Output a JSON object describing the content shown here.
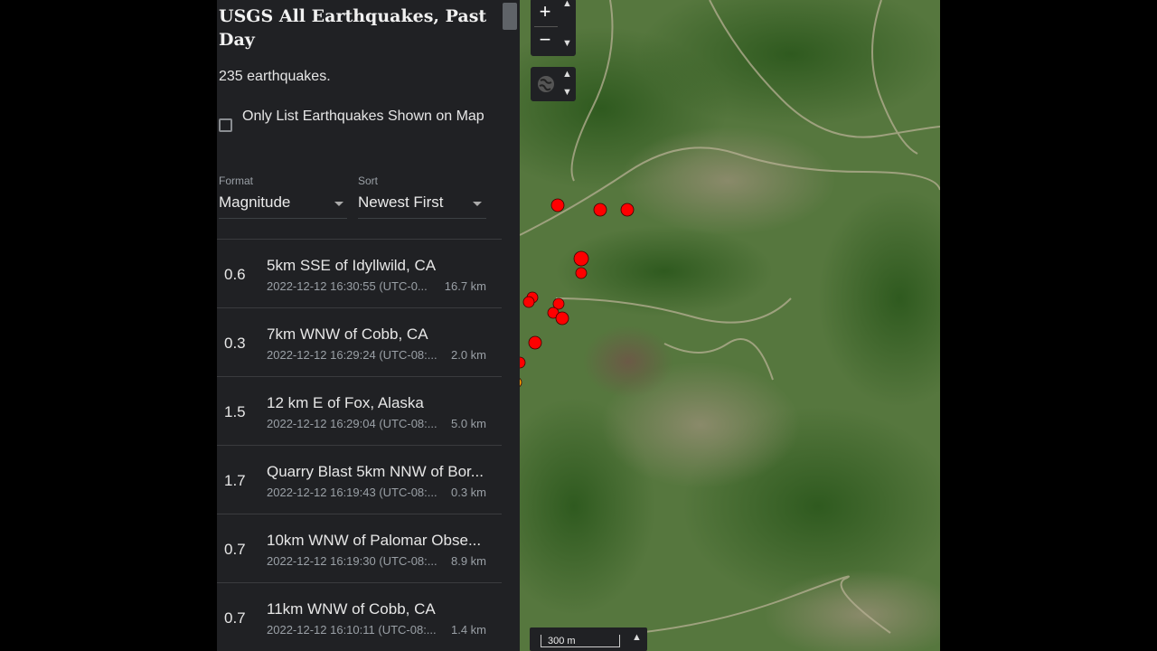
{
  "sidebar": {
    "title": "USGS All Earthquakes, Past Day",
    "count_text": "235 earthquakes.",
    "only_list_label": "Only List Earthquakes Shown on Map",
    "format": {
      "caption": "Format",
      "value": "Magnitude"
    },
    "sort": {
      "caption": "Sort",
      "value": "Newest First"
    },
    "events": [
      {
        "mag": "0.6",
        "place": "5km SSE of Idyllwild, CA",
        "time": "2022-12-12 16:30:55 (UTC-0...",
        "depth": "16.7 km"
      },
      {
        "mag": "0.3",
        "place": "7km WNW of Cobb, CA",
        "time": "2022-12-12 16:29:24 (UTC-08:...",
        "depth": "2.0 km"
      },
      {
        "mag": "1.5",
        "place": "12 km E of Fox, Alaska",
        "time": "2022-12-12 16:29:04 (UTC-08:...",
        "depth": "5.0 km"
      },
      {
        "mag": "1.7",
        "place": "Quarry Blast 5km NNW of Bor...",
        "time": "2022-12-12 16:19:43 (UTC-08:...",
        "depth": "0.3 km"
      },
      {
        "mag": "0.7",
        "place": "10km WNW of Palomar Obse...",
        "time": "2022-12-12 16:19:30 (UTC-08:...",
        "depth": "8.9 km"
      },
      {
        "mag": "0.7",
        "place": "11km WNW of Cobb, CA",
        "time": "2022-12-12 16:10:11 (UTC-08:...",
        "depth": "1.4 km"
      }
    ]
  },
  "map": {
    "zoom_in": "+",
    "zoom_out": "−",
    "scale_label": "300 m",
    "colors": {
      "recent": "#ff0000",
      "older": "#ffa500",
      "panel": "#202124"
    }
  }
}
